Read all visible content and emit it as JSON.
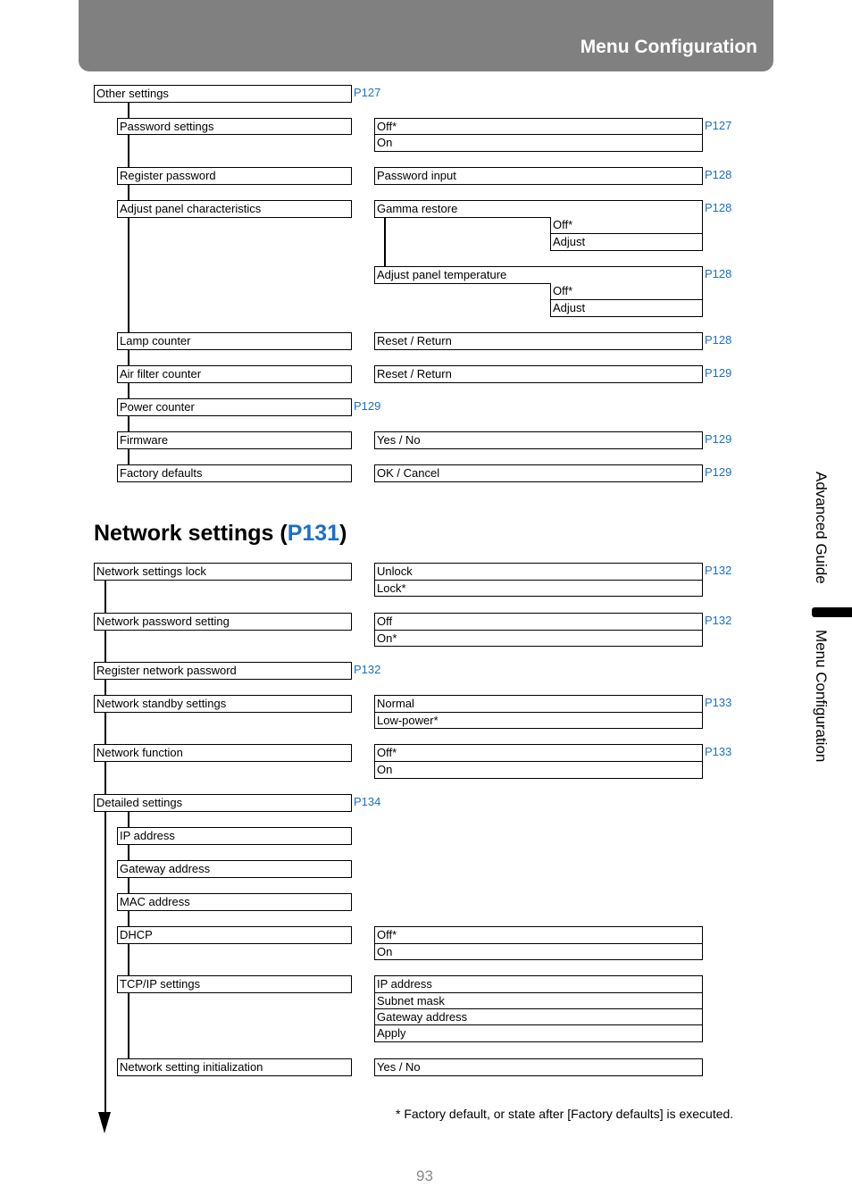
{
  "header": {
    "title": "Menu Configuration"
  },
  "side_tabs": {
    "section": "Advanced Guide",
    "current": "Menu Configuration"
  },
  "other_settings": {
    "root": {
      "label": "Other settings",
      "ref": "P127"
    },
    "items": [
      {
        "label": "Password settings",
        "options": [
          "Off*",
          "On"
        ],
        "ref": "P127"
      },
      {
        "label": "Register password",
        "options": [
          "Password input"
        ],
        "ref": "P128"
      },
      {
        "label": "Adjust panel characteristics",
        "sub": [
          {
            "label": "Gamma restore",
            "options": [
              "Off*",
              "Adjust"
            ],
            "ref": "P128"
          },
          {
            "label": "Adjust panel temperature",
            "options": [
              "Off*",
              "Adjust"
            ],
            "ref": "P128"
          }
        ]
      },
      {
        "label": "Lamp counter",
        "options": [
          "Reset / Return"
        ],
        "ref": "P128"
      },
      {
        "label": "Air filter counter",
        "options": [
          "Reset / Return"
        ],
        "ref": "P129"
      },
      {
        "label": "Power counter",
        "ref": "P129"
      },
      {
        "label": "Firmware",
        "options": [
          "Yes / No"
        ],
        "ref": "P129"
      },
      {
        "label": "Factory defaults",
        "options": [
          "OK / Cancel"
        ],
        "ref": "P129"
      }
    ]
  },
  "network": {
    "heading": "Network settings (",
    "heading_ref": "P131",
    "heading_close": ")",
    "items": [
      {
        "label": "Network settings lock",
        "options": [
          "Unlock",
          "Lock*"
        ],
        "ref": "P132"
      },
      {
        "label": "Network password setting",
        "options": [
          "Off",
          "On*"
        ],
        "ref": "P132"
      },
      {
        "label": "Register network password",
        "ref": "P132"
      },
      {
        "label": "Network standby settings",
        "options": [
          "Normal",
          "Low-power*"
        ],
        "ref": "P133"
      },
      {
        "label": "Network function",
        "options": [
          "Off*",
          "On"
        ],
        "ref": "P133"
      },
      {
        "label": "Detailed settings",
        "ref": "P134"
      }
    ],
    "detailed": [
      {
        "label": "IP address"
      },
      {
        "label": "Gateway address"
      },
      {
        "label": "MAC address"
      },
      {
        "label": "DHCP",
        "options": [
          "Off*",
          "On"
        ]
      },
      {
        "label": "TCP/IP settings",
        "options": [
          "IP address",
          "Subnet mask",
          "Gateway address",
          "Apply"
        ]
      },
      {
        "label": "Network setting initialization",
        "options": [
          "Yes / No"
        ]
      }
    ]
  },
  "footnote": "*  Factory default, or state after [Factory defaults] is executed.",
  "page_number": "93"
}
